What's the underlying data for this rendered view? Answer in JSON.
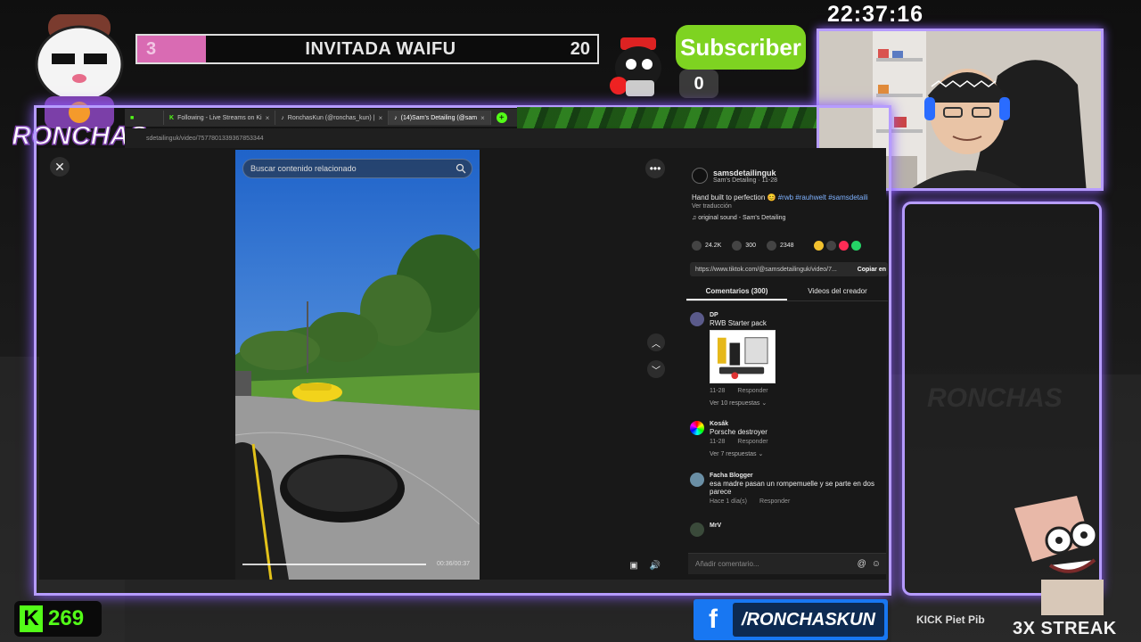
{
  "overlay": {
    "goal": {
      "current": "3",
      "title": "INVITADA WAIFU",
      "max": "20",
      "fill_fraction": 0.15
    },
    "subscriber": {
      "label": "Subscriber",
      "count": "0"
    },
    "clock": "22:37:16",
    "kick_count": "269",
    "facebook_handle": "/RONCHASKUN",
    "logo_text": "RONCHAS",
    "watermark": "RONCHAS",
    "socials": "KICK  Piet  Pib",
    "streak": "3X STREAK",
    "colors": {
      "frame": "#b69cff",
      "kick": "#53fc18",
      "goal_fill": "#d96bb3",
      "sub_green": "#7ed321"
    }
  },
  "browser": {
    "tabs": [
      {
        "label": "Following - Live Streams on Ki",
        "active": false
      },
      {
        "label": "RonchasKun (@ronchas_kun) |",
        "active": false
      },
      {
        "label": "(14)Sam's Detailing (@sam",
        "active": true
      }
    ],
    "url": "sdetailinguk/video/7577801339367853344"
  },
  "tiktok": {
    "search_placeholder": "Buscar contenido relacionado",
    "video_time": "00:36/00:37",
    "progress_fraction": 0.96,
    "author": {
      "username": "samsdetailinguk",
      "subtitle": "Sam's Detailing · 11-28"
    },
    "caption": "Hand built to perfection",
    "hashtags": "#rwb #rauhwelt #samsdetaili",
    "translate": "Ver traducción",
    "sound": "original sound - Sam's Detailing",
    "stats": {
      "likes": "24.2K",
      "comments": "300",
      "saves": "2348"
    },
    "link": "https://www.tiktok.com/@samsdetailinguk/video/7...",
    "copy_label": "Copiar en",
    "tabs": {
      "comments": "Comentarios (300)",
      "creator_videos": "Videos del creador"
    },
    "comments": [
      {
        "user": "DP",
        "text": "RWB Starter pack",
        "date": "11-28",
        "reply": "Responder",
        "more": "Ver 10 respuestas"
      },
      {
        "user": "Kosák",
        "text": "Porsche destroyer",
        "date": "11-28",
        "reply": "Responder",
        "more": "Ver 7 respuestas"
      },
      {
        "user": "Facha Blogger",
        "text": "esa madre pasan un rompemuelle y se parte en dos parece",
        "date": "Hace 1 día(s)",
        "reply": "Responder",
        "more": ""
      },
      {
        "user": "MrV",
        "text": "",
        "date": "",
        "reply": "",
        "more": ""
      }
    ],
    "add_comment_placeholder": "Añadir comentario..."
  }
}
